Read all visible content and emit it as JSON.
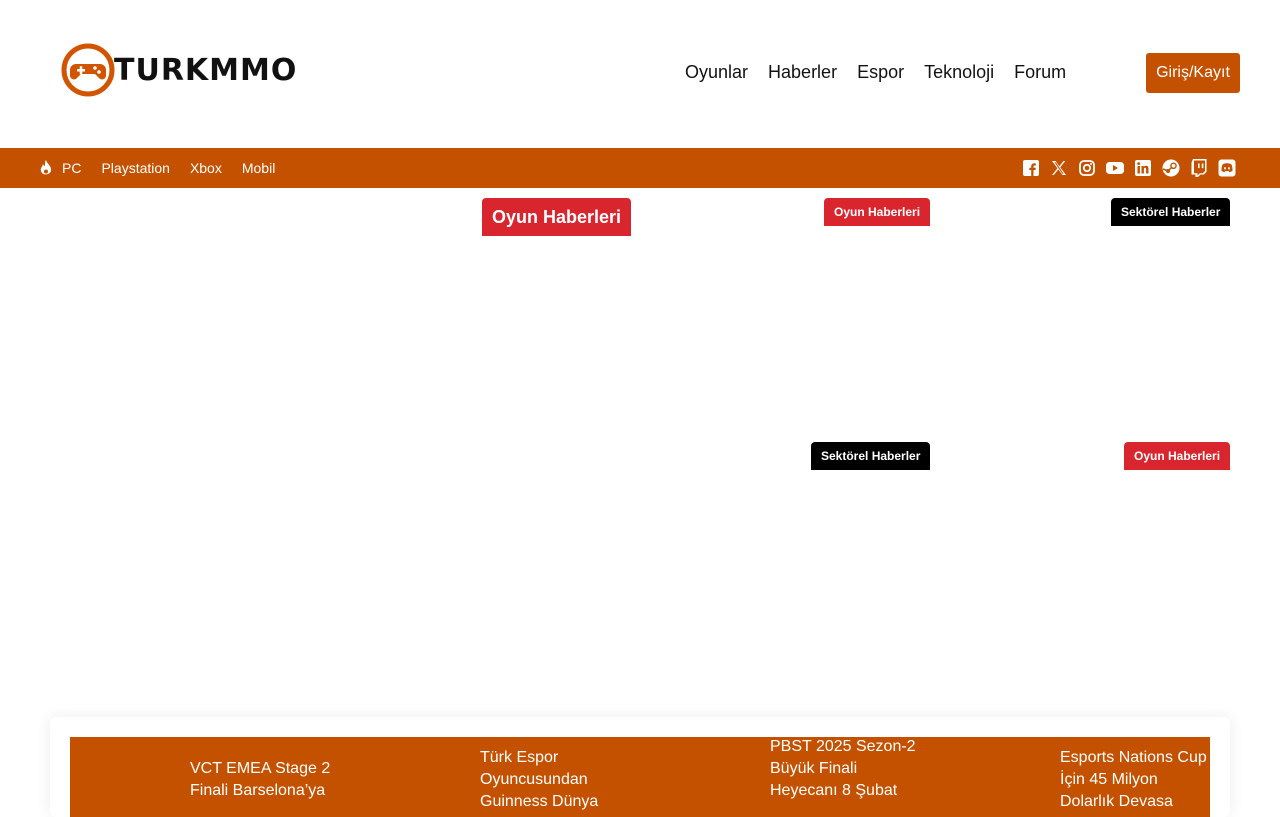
{
  "brand": {
    "name": "TURKMMO",
    "accent": "#c45100"
  },
  "nav": {
    "items": [
      "Oyunlar",
      "Haberler",
      "Espor",
      "Teknoloji",
      "Forum"
    ],
    "login_label": "Giriş/Kayıt"
  },
  "subnav": {
    "items": [
      "PC",
      "Playstation",
      "Xbox",
      "Mobil"
    ]
  },
  "social_icons": [
    "facebook-icon",
    "x-icon",
    "instagram-icon",
    "youtube-icon",
    "linkedin-icon",
    "steam-icon",
    "twitch-icon",
    "discord-icon"
  ],
  "featured_tags": [
    {
      "label": "Oyun Haberleri",
      "color": "#d9262e"
    },
    {
      "label": "Oyun Haberleri",
      "color": "#d9262e"
    },
    {
      "label": "Sektörel Haberler",
      "color": "#000000"
    },
    {
      "label": "Sektörel Haberler",
      "color": "#000000"
    },
    {
      "label": "Oyun Haberleri",
      "color": "#d9262e"
    }
  ],
  "ticker": [
    {
      "text": "VCT EMEA Stage 2\nFinali Barselona’ya"
    },
    {
      "text": "Türk Espor\nOyuncusundan\nGuinness Dünya"
    },
    {
      "text": "PBST 2025 Sezon-2\nBüyük Finali\nHeyecanı 8 Şubat"
    },
    {
      "text": "Esports Nations Cup\nİçin 45 Milyon\nDolarlık Devasa"
    }
  ]
}
